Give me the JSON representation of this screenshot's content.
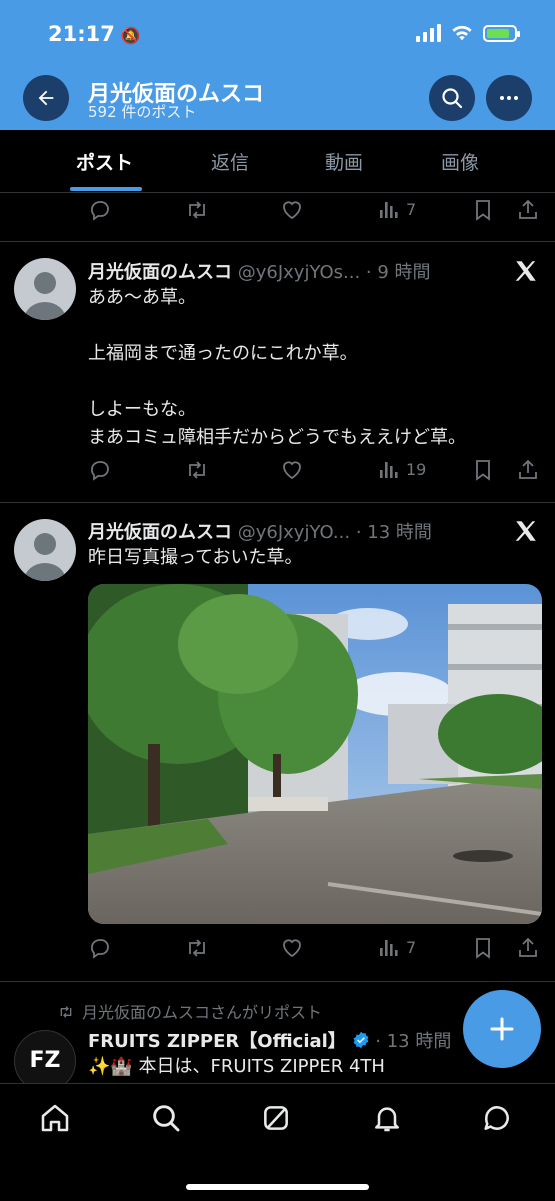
{
  "status_bar": {
    "time": "21:17"
  },
  "header": {
    "title": "月光仮面のムスコ",
    "subtitle": "592 件のポスト"
  },
  "tabs": [
    {
      "label": "ポスト",
      "active": true
    },
    {
      "label": "返信"
    },
    {
      "label": "動画"
    },
    {
      "label": "画像"
    }
  ],
  "top_actions": {
    "views": "7"
  },
  "tweets": [
    {
      "name": "月光仮面のムスコ",
      "handle": "@y6JxyjYOs...",
      "time": "· 9 時間",
      "text": "ああ〜あ草。\n\n上福岡まで通ったのにこれか草。\n\nしよーもな。\nまあコミュ障相手だからどうでもええけど草。",
      "views": "19"
    },
    {
      "name": "月光仮面のムスコ",
      "handle": "@y6JxyjYO...",
      "time": "· 13 時間",
      "text": "昨日写真撮っておいた草。",
      "views": "7"
    }
  ],
  "repost": {
    "label": "月光仮面のムスコさんがリポスト",
    "name": "FRUITS ZIPPER【Official】",
    "time": "· 13 時間",
    "text": "✨🏰 本日は、FRUITS ZIPPER 4TH",
    "avatar_text": "FZ"
  },
  "colors": {
    "accent": "#4a9be6",
    "muted": "#71767b",
    "verified": "#1d9bf0"
  },
  "icons": [
    "back-arrow-icon",
    "search-icon",
    "more-icon",
    "reply-icon",
    "repost-icon",
    "like-icon",
    "views-icon",
    "bookmark-icon",
    "share-icon",
    "x-logo-icon",
    "plus-icon",
    "home-icon",
    "grok-icon",
    "bell-icon",
    "messages-icon"
  ]
}
